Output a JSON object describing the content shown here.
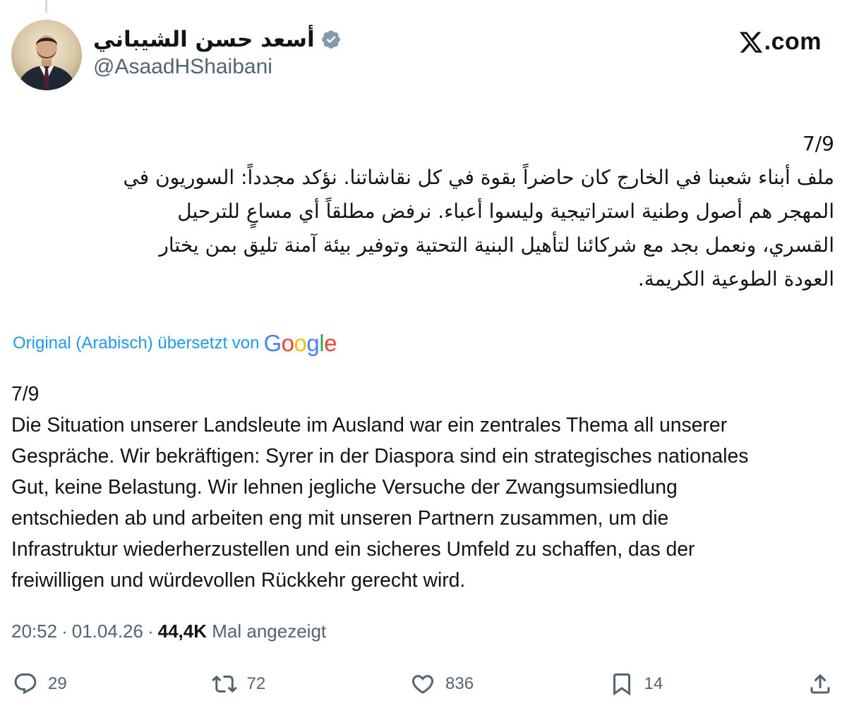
{
  "author": {
    "display_name": "أسعد حسن الشيباني",
    "handle": "@AsaadHShaibani",
    "verified": true
  },
  "source": {
    "label": ".com",
    "logo_icon": "x-logo-icon"
  },
  "tweet": {
    "counter": "7/9",
    "original_lines": [
      "ملف أبناء شعبنا في الخارج كان حاضراً بقوة في كل نقاشاتنا. نؤكد مجدداً: السوريون في",
      "المهجر هم أصول وطنية استراتيجية وليسوا أعباء. نرفض مطلقاً أي مساعٍ للترحيل",
      "القسري، ونعمل بجد مع شركائنا لتأهيل البنية التحتية وتوفير بيئة آمنة تليق بمن يختار",
      "العودة الطوعية الكريمة."
    ],
    "translation_label": "Original (Arabisch) übersetzt von",
    "translation_provider": "Google",
    "translated_counter": "7/9",
    "translated_lines": [
      "Die Situation unserer Landsleute im Ausland war ein zentrales Thema all unserer",
      "Gespräche. Wir bekräftigen: Syrer in der Diaspora sind ein strategisches nationales",
      "Gut, keine Belastung. Wir lehnen jegliche Versuche der Zwangsumsiedlung",
      "entschieden ab und arbeiten eng mit unseren Partnern zusammen, um die",
      "Infrastruktur wiederherzustellen und ein sicheres Umfeld zu schaffen, das der",
      "freiwilligen und würdevollen Rückkehr gerecht wird."
    ]
  },
  "meta": {
    "time": "20:52",
    "separator": "·",
    "date": "01.04.26",
    "views": "44,4K",
    "views_label": "Mal angezeigt"
  },
  "actions": {
    "replies": "29",
    "reposts": "72",
    "likes": "836",
    "bookmarks": "14"
  },
  "colors": {
    "text": "#0f1419",
    "secondary": "#536471",
    "link": "#1d9bf0",
    "verified_badge": "#829aab"
  }
}
